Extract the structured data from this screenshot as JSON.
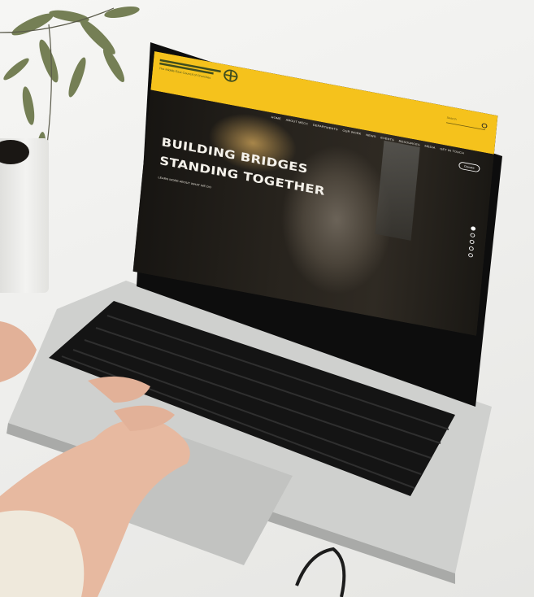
{
  "site": {
    "logo": {
      "tagline": "The Middle East Council of Churches"
    },
    "search": {
      "placeholder": "Search"
    },
    "nav": [
      "HOME",
      "ABOUT MECC",
      "DEPARTMENTS",
      "OUR WORK",
      "NEWS",
      "EVENTS",
      "RESOURCES",
      "MEDIA",
      "GET IN TOUCH"
    ],
    "donate_label": "Donate",
    "hero": {
      "headline_line1": "BUILDING BRIDGES",
      "headline_line2": "STANDING TOGETHER",
      "link_text": "LEARN MORE ABOUT WHAT WE DO"
    },
    "slider": {
      "count": 5,
      "active_index": 0
    }
  },
  "colors": {
    "header_yellow": "#f5c21c",
    "logo_green": "#3f4d1e",
    "hero_dark": "#1b1915",
    "laptop_silver": "#c9c9c7",
    "keyboard_black": "#141414"
  }
}
